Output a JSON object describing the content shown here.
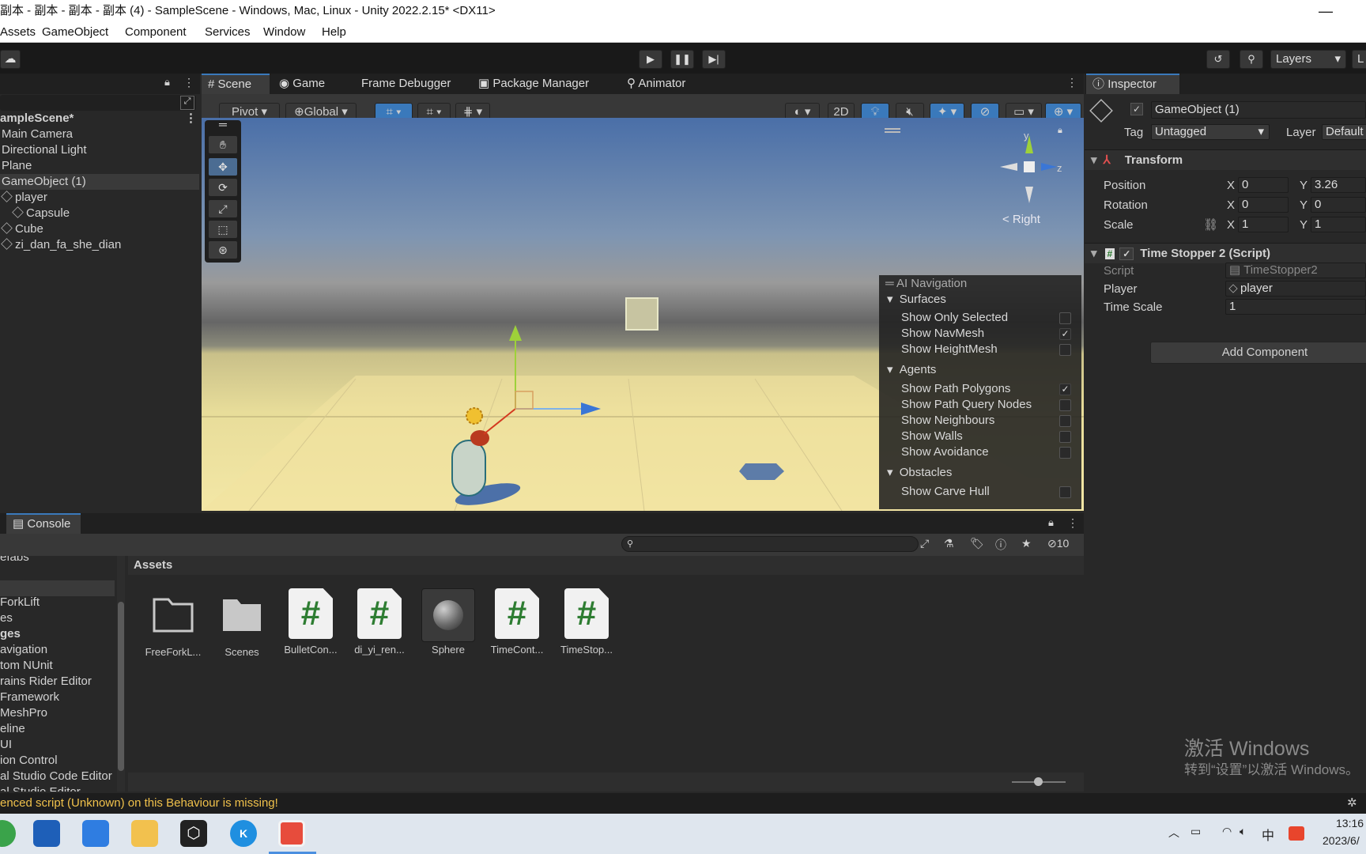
{
  "window": {
    "title": "副本 - 副本 - 副本 - 副本 (4) - SampleScene - Windows, Mac, Linux - Unity 2022.2.15* <DX11>",
    "minimize_glyph": "—"
  },
  "menu": [
    "Assets",
    "GameObject",
    "Component",
    "Services",
    "Window",
    "Help"
  ],
  "toolbar": {
    "layers_label": "Layers",
    "layout_label": "L"
  },
  "hierarchy": {
    "scene": "ampleScene*",
    "items": [
      "Main Camera",
      "Directional Light",
      "Plane",
      "GameObject (1)",
      "player",
      "Capsule",
      "Cube",
      "zi_dan_fa_she_dian"
    ]
  },
  "tabs": {
    "scene": "Scene",
    "game": "Game",
    "frame_debugger": "Frame Debugger",
    "package_manager": "Package Manager",
    "animator": "Animator",
    "inspector": "Inspector",
    "console": "Console"
  },
  "scene_toolbar": {
    "pivot": "Pivot",
    "global": "Global",
    "mode_2d": "2D"
  },
  "gizmo": {
    "y": "y",
    "z": "z",
    "view": "< Right"
  },
  "ai_navigation": {
    "title": "AI Navigation",
    "sections": [
      {
        "name": "Surfaces",
        "items": [
          {
            "label": "Show Only Selected",
            "checked": false
          },
          {
            "label": "Show NavMesh",
            "checked": true
          },
          {
            "label": "Show HeightMesh",
            "checked": false
          }
        ]
      },
      {
        "name": "Agents",
        "items": [
          {
            "label": "Show Path Polygons",
            "checked": true
          },
          {
            "label": "Show Path Query Nodes",
            "checked": false
          },
          {
            "label": "Show Neighbours",
            "checked": false
          },
          {
            "label": "Show Walls",
            "checked": false
          },
          {
            "label": "Show Avoidance",
            "checked": false
          }
        ]
      },
      {
        "name": "Obstacles",
        "items": [
          {
            "label": "Show Carve Hull",
            "checked": false
          }
        ]
      }
    ],
    "check_glyph": "✓"
  },
  "inspector": {
    "object_name": "GameObject (1)",
    "tag_label": "Tag",
    "tag_value": "Untagged",
    "layer_label": "Layer",
    "layer_value": "Default",
    "transform": {
      "title": "Transform",
      "position_label": "Position",
      "rotation_label": "Rotation",
      "scale_label": "Scale",
      "x_label": "X",
      "y_label": "Y",
      "position": {
        "x": "0",
        "y": "3.26"
      },
      "rotation": {
        "x": "0",
        "y": "0"
      },
      "scale": {
        "x": "1",
        "y": "1"
      }
    },
    "script": {
      "title": "Time Stopper 2 (Script)",
      "script_label": "Script",
      "script_value": "TimeStopper2",
      "player_label": "Player",
      "player_value": "player",
      "timescale_label": "Time Scale",
      "timescale_value": "1"
    },
    "add_component": "Add Component"
  },
  "project": {
    "left_items": [
      "efabs",
      "",
      "ForkLift",
      "es",
      "ges",
      "avigation",
      "tom NUnit",
      "rains Rider Editor",
      "Framework",
      "MeshPro",
      "eline",
      "UI",
      "ion Control",
      "al Studio Code Editor",
      "al Studio Editor"
    ],
    "breadcrumb": "Assets",
    "hidden_count": "10",
    "assets": [
      {
        "name": "FreeForkL...",
        "kind": "folder-outline"
      },
      {
        "name": "Scenes",
        "kind": "folder"
      },
      {
        "name": "BulletCon...",
        "kind": "script"
      },
      {
        "name": "di_yi_ren...",
        "kind": "script"
      },
      {
        "name": "Sphere",
        "kind": "material"
      },
      {
        "name": "TimeCont...",
        "kind": "script"
      },
      {
        "name": "TimeStop...",
        "kind": "script"
      }
    ]
  },
  "watermark": {
    "line1": "激活 Windows",
    "line2": "转到“设置”以激活 Windows。"
  },
  "status": {
    "message": "enced script (Unknown) on this Behaviour is missing!"
  },
  "tray": {
    "ime": "中",
    "time": "13:16",
    "date": "2023/6/"
  },
  "colors": {
    "accent": "#3a79bb",
    "warning": "#f0c14b",
    "script_icon": "#2e7d32"
  }
}
